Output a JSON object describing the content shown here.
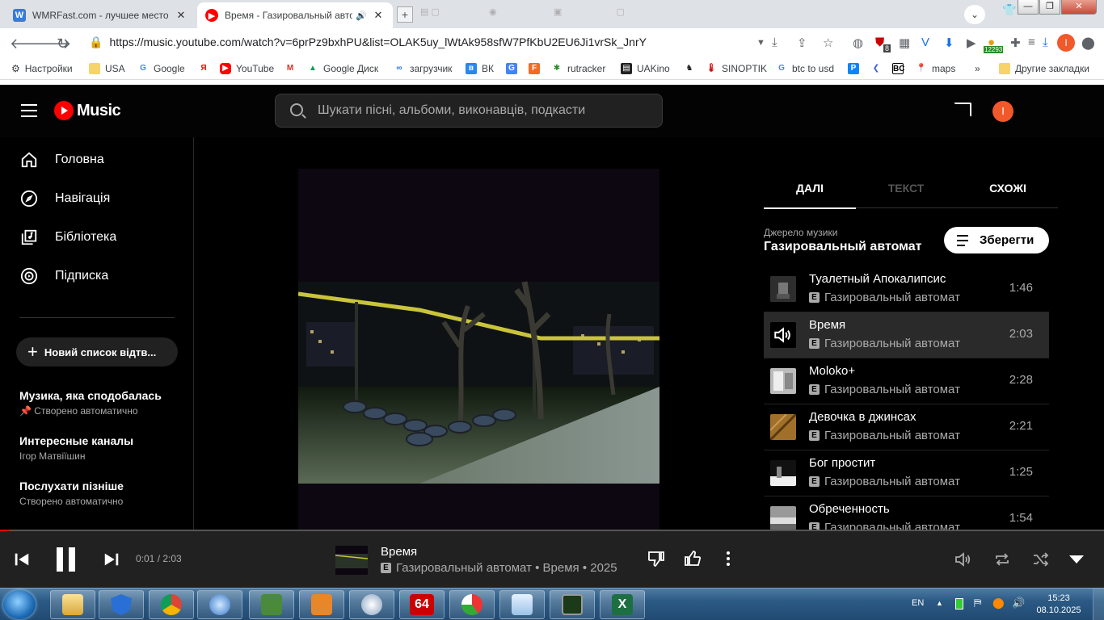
{
  "browser": {
    "tabs": [
      {
        "title": "WMRFast.com - лучшее место для",
        "favicon": "W"
      },
      {
        "title": "Время - Газировальный автомат",
        "favicon": "yt-music"
      }
    ],
    "url": "https://music.youtube.com/watch?v=6prPz9bxhPU&list=OLAK5uy_lWtAk958sfW7PfKbU2EU6Ji1vrSk_JnrY",
    "extension_badge_1": "8",
    "extension_badge_2": "12293",
    "profile_letter": "I",
    "bookmarks": [
      "Настройки",
      "USA",
      "Google",
      "YouTube",
      "Google Диск",
      "загрузчик",
      "ВК",
      "rutracker",
      "UAKino",
      "SINOPTIK",
      "btc to usd",
      "maps"
    ],
    "bookmarks_more": "»",
    "other_bookmarks": "Другие закладки"
  },
  "ytm": {
    "logo_text": "Music",
    "search_placeholder": "Шукати пісні, альбоми, виконавців, подкасти",
    "avatar_letter": "I",
    "nav": [
      {
        "label": "Головна",
        "icon": "home-icon"
      },
      {
        "label": "Навігація",
        "icon": "compass-icon"
      },
      {
        "label": "Бібліотека",
        "icon": "library-icon"
      },
      {
        "label": "Підписка",
        "icon": "subscription-icon"
      }
    ],
    "new_playlist": "Новий список відтв...",
    "playlists": [
      {
        "title": "Музика, яка сподобалась",
        "subtitle": "Створено автоматично",
        "pinned": true
      },
      {
        "title": "Интересные каналы",
        "subtitle": "Ігор Матвіїшин",
        "pinned": false
      },
      {
        "title": "Послухати пізніше",
        "subtitle": "Створено автоматично",
        "pinned": false
      }
    ],
    "queue": {
      "tabs": [
        "ДАЛІ",
        "ТЕКСТ",
        "СХОЖІ"
      ],
      "source_label": "Джерело музики",
      "source_name": "Газировальный автомат",
      "save_label": "Зберегти",
      "explicit_badge": "E",
      "tracks": [
        {
          "title": "Туалетный Апокалипсис",
          "artist": "Газировальный автомат",
          "duration": "1:46",
          "playing": false
        },
        {
          "title": "Время",
          "artist": "Газировальный автомат",
          "duration": "2:03",
          "playing": true
        },
        {
          "title": "Moloko+",
          "artist": "Газировальный автомат",
          "duration": "2:28",
          "playing": false
        },
        {
          "title": "Девочка в джинсах",
          "artist": "Газировальный автомат",
          "duration": "2:21",
          "playing": false
        },
        {
          "title": "Бог простит",
          "artist": "Газировальный автомат",
          "duration": "1:25",
          "playing": false
        },
        {
          "title": "Обреченность",
          "artist": "Газировальный автомат",
          "duration": "1:54",
          "playing": false
        }
      ]
    },
    "player": {
      "time": "0:01 / 2:03",
      "progress_fraction": 0.008,
      "title": "Время",
      "meta": "Газировальный автомат • Время • 2025"
    }
  },
  "taskbar": {
    "lang": "EN",
    "time": "15:23",
    "date": "08.10.2025",
    "app_64_label": "64"
  },
  "colors": {
    "accent_red": "#ff0000",
    "avatar_orange": "#f1592a",
    "bg": "#030303"
  }
}
